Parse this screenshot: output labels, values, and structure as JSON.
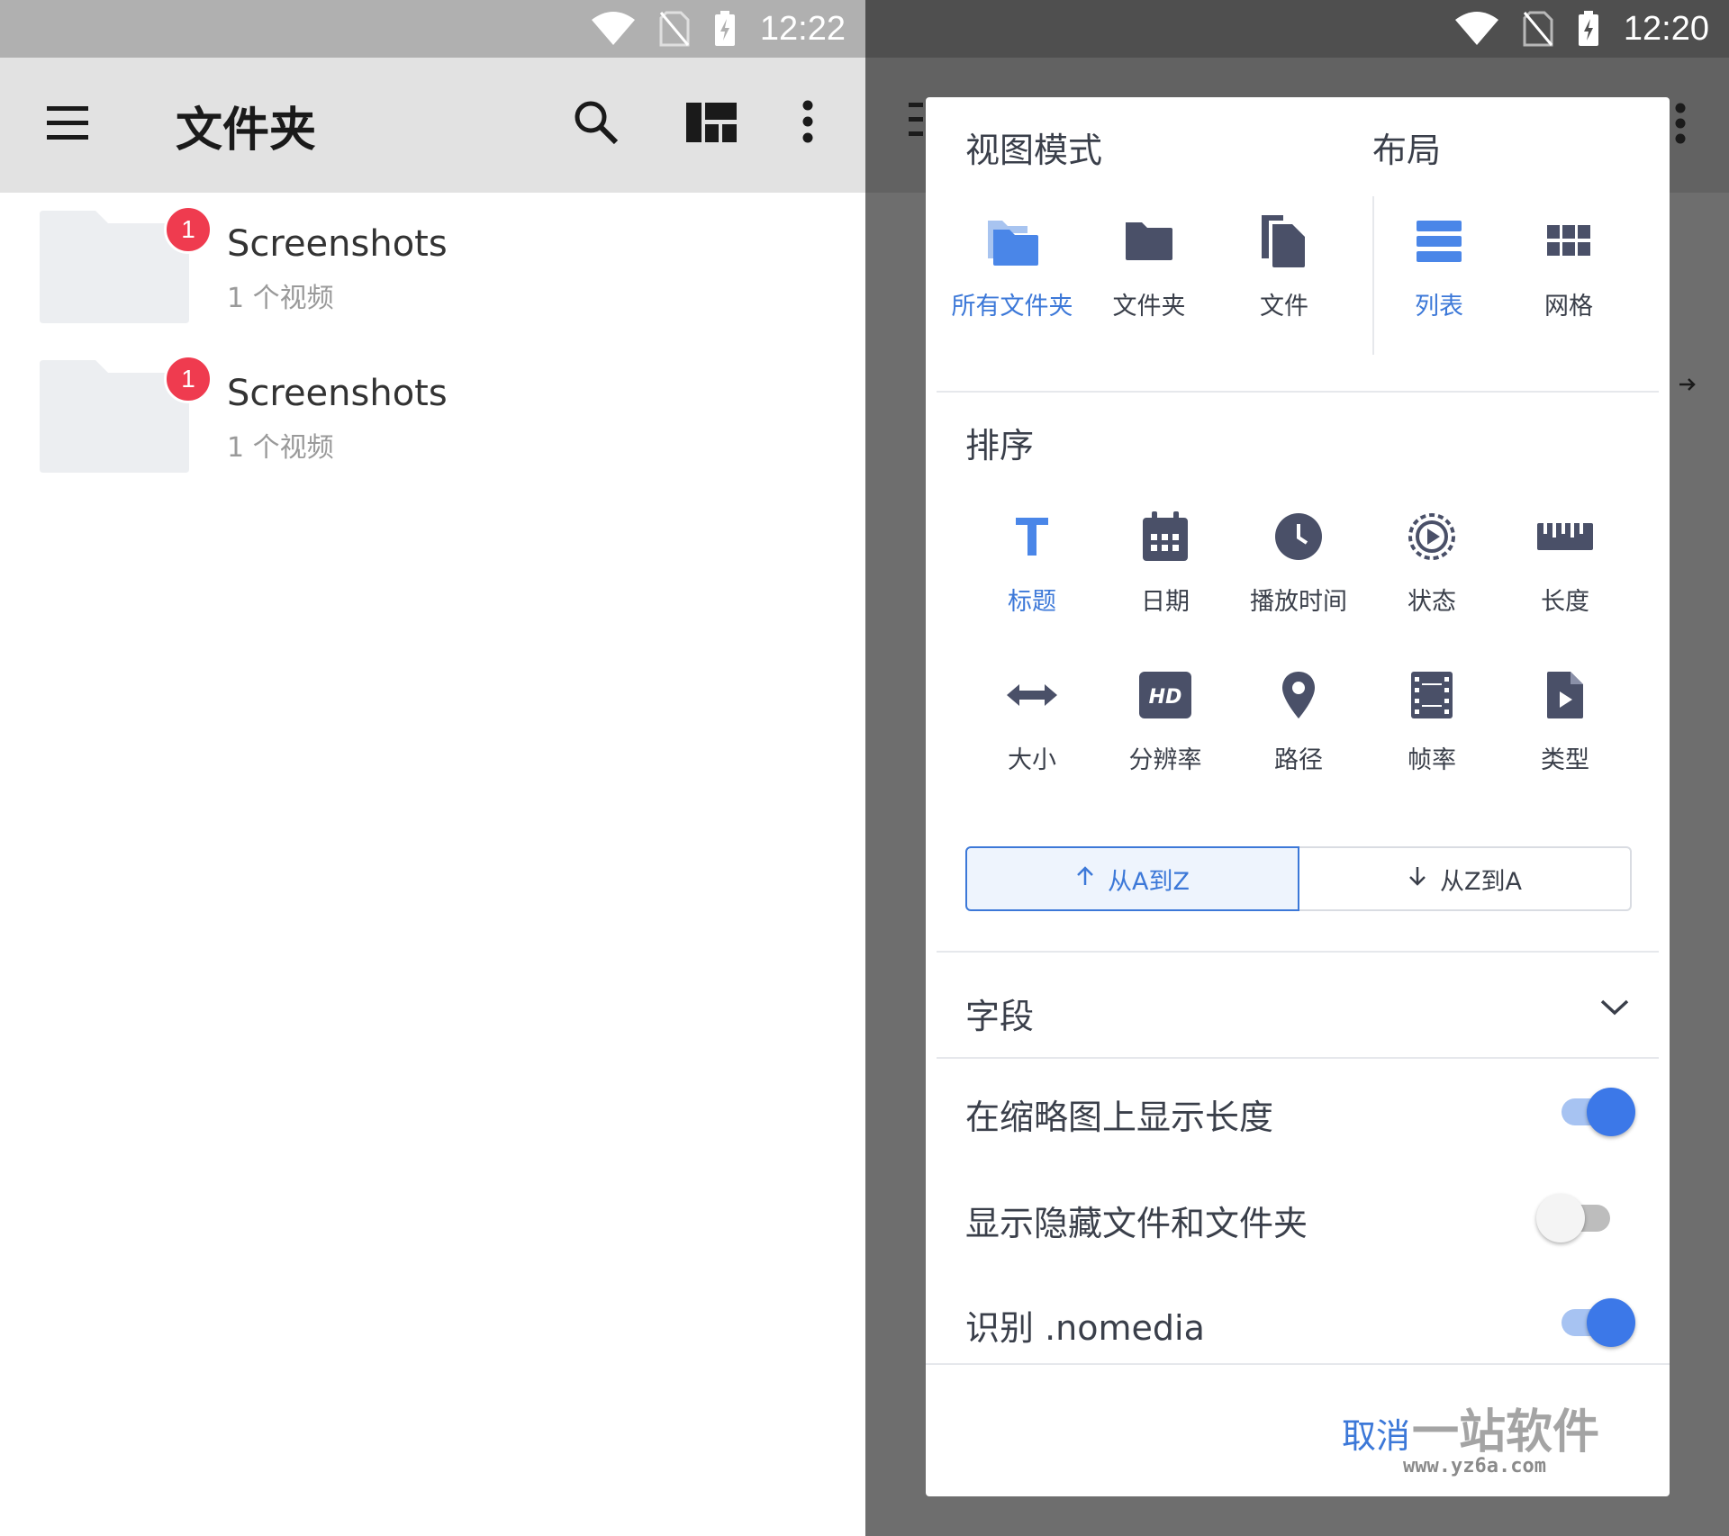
{
  "left": {
    "status": {
      "time": "12:22"
    },
    "appbar": {
      "title": "文件夹"
    },
    "folders": [
      {
        "name": "Screenshots",
        "sub": "1 个视频",
        "badge": "1"
      },
      {
        "name": "Screenshots",
        "sub": "1 个视频",
        "badge": "1"
      }
    ]
  },
  "right": {
    "status": {
      "time": "12:20"
    },
    "dialog": {
      "view_mode_title": "视图模式",
      "layout_title": "布局",
      "view_modes": [
        {
          "label": "所有文件夹",
          "icon": "folder-stack-icon",
          "selected": true
        },
        {
          "label": "文件夹",
          "icon": "folder-icon",
          "selected": false
        },
        {
          "label": "文件",
          "icon": "files-icon",
          "selected": false
        }
      ],
      "layouts": [
        {
          "label": "列表",
          "icon": "list-icon",
          "selected": true
        },
        {
          "label": "网格",
          "icon": "grid-icon",
          "selected": false
        }
      ],
      "sort_title": "排序",
      "sort_options": [
        {
          "label": "标题",
          "icon": "title-icon",
          "selected": true
        },
        {
          "label": "日期",
          "icon": "calendar-icon",
          "selected": false
        },
        {
          "label": "播放时间",
          "icon": "clock-icon",
          "selected": false
        },
        {
          "label": "状态",
          "icon": "status-play-icon",
          "selected": false
        },
        {
          "label": "长度",
          "icon": "ruler-icon",
          "selected": false
        },
        {
          "label": "大小",
          "icon": "resize-icon",
          "selected": false
        },
        {
          "label": "分辨率",
          "icon": "hd-icon",
          "selected": false
        },
        {
          "label": "路径",
          "icon": "location-pin-icon",
          "selected": false
        },
        {
          "label": "帧率",
          "icon": "film-icon",
          "selected": false
        },
        {
          "label": "类型",
          "icon": "video-file-icon",
          "selected": false
        }
      ],
      "order_asc": "从A到Z",
      "order_desc": "从Z到A",
      "fields_title": "字段",
      "toggles": [
        {
          "label": "在缩略图上显示长度",
          "on": true
        },
        {
          "label": "显示隐藏文件和文件夹",
          "on": false
        },
        {
          "label": "识别 .nomedia",
          "on": true
        }
      ],
      "cancel_label": "取消"
    },
    "watermark": {
      "text": "一站软件",
      "url": "www.yz6a.com"
    }
  },
  "colors": {
    "accent": "#3c78d8",
    "icon": "#4a5068",
    "badge": "#ef3b4f",
    "folder_thumb": "#eceef1"
  }
}
